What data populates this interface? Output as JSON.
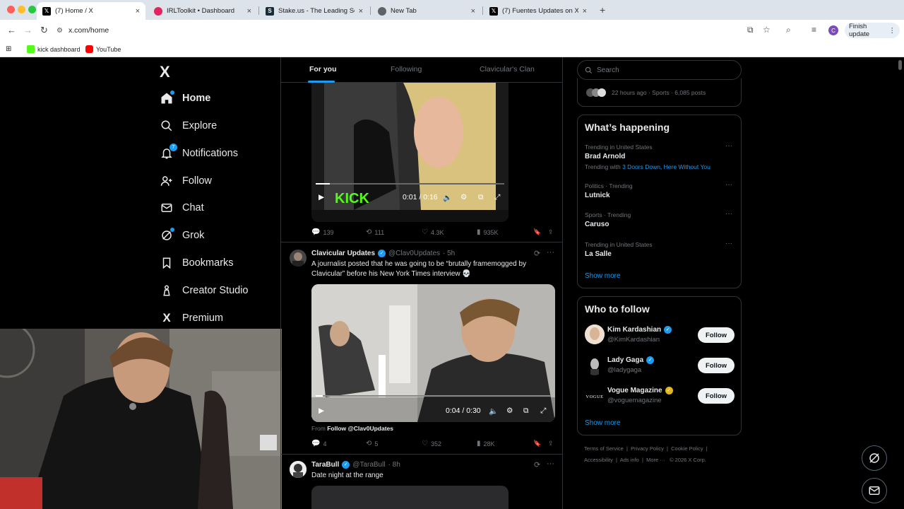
{
  "browser": {
    "tabs": [
      {
        "title": "(7) Home / X",
        "favicon": "x-icon"
      },
      {
        "title": "IRLToolkit • Dashboard",
        "favicon": "irltoolkit-icon"
      },
      {
        "title": "Stake.us - The Leading Socia",
        "favicon": "stake-icon"
      },
      {
        "title": "New Tab",
        "favicon": "chrome-icon"
      },
      {
        "title": "(7) Fuentes Updates on X: \"C",
        "favicon": "x-icon"
      }
    ],
    "url": "x.com/home",
    "finish_update": "Finish update",
    "profile_initial": "C",
    "bookmarks": [
      {
        "label": "kick dashboard"
      },
      {
        "label": "YouTube"
      }
    ]
  },
  "sidebar": {
    "logo": "X",
    "items": [
      {
        "label": "Home",
        "icon": "home-icon"
      },
      {
        "label": "Explore",
        "icon": "search-icon"
      },
      {
        "label": "Notifications",
        "icon": "bell-icon",
        "badge": "7"
      },
      {
        "label": "Follow",
        "icon": "follow-icon"
      },
      {
        "label": "Chat",
        "icon": "mail-icon"
      },
      {
        "label": "Grok",
        "icon": "grok-icon"
      },
      {
        "label": "Bookmarks",
        "icon": "bookmark-icon"
      },
      {
        "label": "Creator Studio",
        "icon": "creator-icon"
      },
      {
        "label": "Premium",
        "icon": "x-premium-icon"
      }
    ]
  },
  "feed": {
    "tabs": [
      "For you",
      "Following",
      "Clavicular's Clan"
    ],
    "post1": {
      "media_overlay": "KICK",
      "time": "0:01 / 0:16",
      "replies": "139",
      "reposts": "111",
      "likes": "4.3K",
      "views": "935K"
    },
    "post2": {
      "name": "Clavicular Updates",
      "handle": "@Clav0Updates",
      "age": "· 5h",
      "text": "A journalist posted that he was going to be “brutally framemogged by Clavicular” before his New York Times interview 💀",
      "time": "0:04 / 0:30",
      "from_prefix": "From",
      "from_link": "Follow @Clav0Updates",
      "replies": "4",
      "reposts": "5",
      "likes": "352",
      "views": "28K"
    },
    "post3": {
      "name": "TaraBull",
      "handle": "@TaraBull",
      "age": "· 8h",
      "text": "Date night at the range"
    }
  },
  "right": {
    "search_placeholder": "Search",
    "live_meta": "22 hours ago · Sports · 6,085 posts",
    "happening_title": "What’s happening",
    "trends": [
      {
        "meta": "Trending in United States",
        "name": "Brad Arnold",
        "with_prefix": "Trending with",
        "with_links": "3 Doors Down, Here Without You"
      },
      {
        "meta": "Politics · Trending",
        "name": "Lutnick"
      },
      {
        "meta": "Sports · Trending",
        "name": "Caruso"
      },
      {
        "meta": "Trending in United States",
        "name": "La Salle"
      }
    ],
    "show_more": "Show more",
    "wtf_title": "Who to follow",
    "wtf": [
      {
        "name": "Kim Kardashian",
        "handle": "@KimKardashian",
        "button": "Follow"
      },
      {
        "name": "Lady Gaga",
        "handle": "@ladygaga",
        "button": "Follow"
      },
      {
        "name": "Vogue Magazine",
        "handle": "@voguemagazine",
        "button": "Follow",
        "avatar_text": "VOGUE"
      }
    ],
    "footer_row1": [
      "Terms of Service",
      "Privacy Policy",
      "Cookie Policy"
    ],
    "footer_row2": [
      "Accessibility",
      "Ads info",
      "More ···",
      "© 2026 X Corp."
    ]
  },
  "colors": {
    "accent": "#1d9bf0",
    "background": "#000000",
    "border": "#2f3336",
    "muted": "#71767b"
  }
}
